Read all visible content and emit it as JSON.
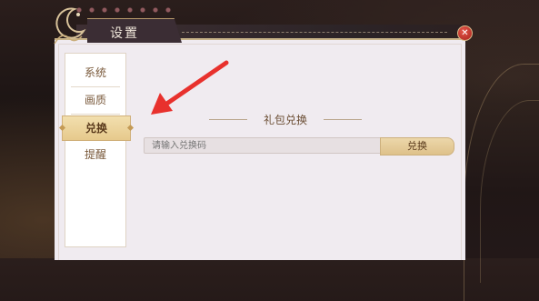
{
  "window": {
    "title": "设置",
    "close_icon": "close-icon"
  },
  "sidebar": {
    "items": [
      {
        "label": "系统",
        "active": false
      },
      {
        "label": "画质",
        "active": false
      },
      {
        "label": "兑换",
        "active": true
      },
      {
        "label": "提醒",
        "active": false
      }
    ]
  },
  "redeem": {
    "section_title": "礼包兑换",
    "input_placeholder": "请输入兑换码",
    "input_value": "",
    "button_label": "兑换"
  },
  "annotation": {
    "icon": "red-arrow-icon",
    "color": "#e8312d"
  },
  "colors": {
    "accent": "#e6c98c",
    "panel": "#f0ebf0",
    "header": "#3b2d34",
    "close": "#c9302a"
  }
}
